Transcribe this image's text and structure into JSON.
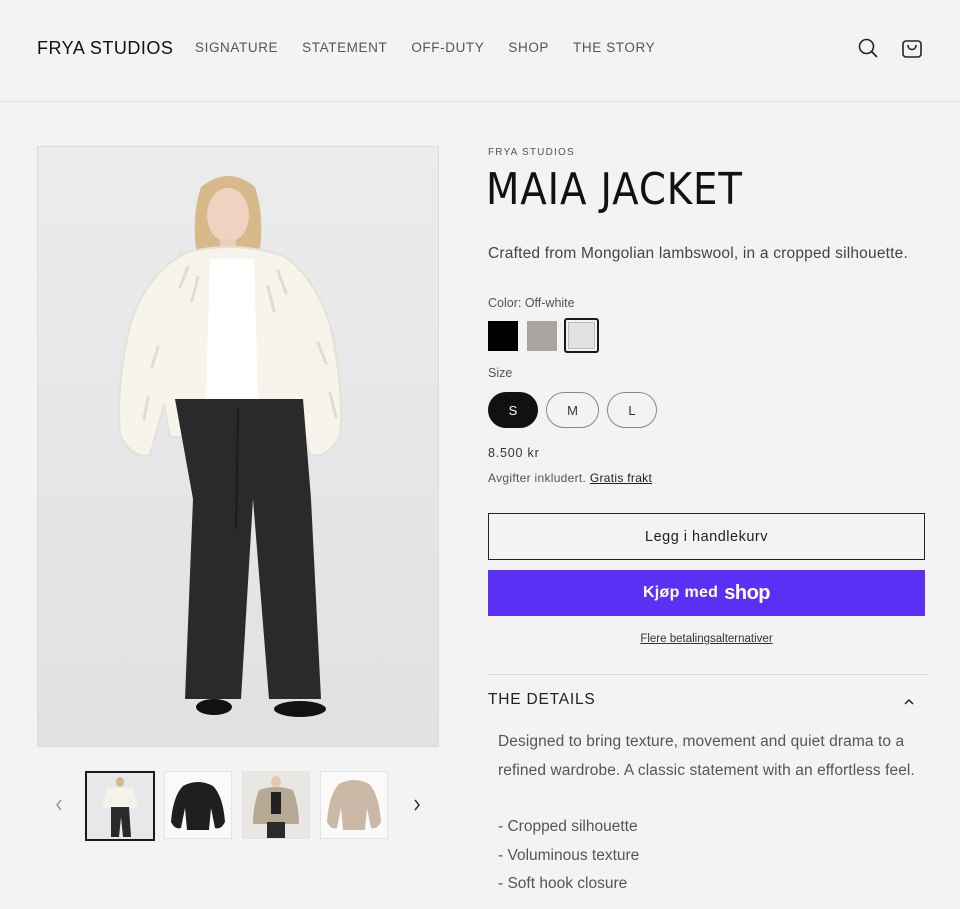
{
  "header": {
    "logo": "FRYA STUDIOS",
    "nav": [
      "SIGNATURE",
      "STATEMENT",
      "OFF-DUTY",
      "SHOP",
      "THE STORY"
    ],
    "icons": [
      "search-icon",
      "cart-icon"
    ]
  },
  "product": {
    "vendor": "FRYA STUDIOS",
    "title": "MAIA JACKET",
    "description": "Crafted from Mongolian lambswool, in a cropped silhouette.",
    "color_label": "Color: Off-white",
    "swatches": [
      {
        "name": "Black",
        "color": "#000000"
      },
      {
        "name": "Taupe",
        "color": "#a9a3a1"
      },
      {
        "name": "Off-white",
        "color": "#e2e2e2",
        "selected": true
      }
    ],
    "size_label": "Size",
    "sizes": [
      "S",
      "M",
      "L"
    ],
    "selected_size": "S",
    "price": "8.500 kr",
    "tax_text": "Avgifter inkludert.",
    "shipping_link": "Gratis frakt",
    "add_to_cart": "Legg i handlekurv",
    "shop_pay_text": "Kjøp med",
    "shop_pay_brand": "shop",
    "shop_pay_color": "#5a31f4",
    "more_payment": "Flere betalingsalternativer"
  },
  "details": {
    "title": "THE DETAILS",
    "body": "Designed to bring texture, movement and quiet drama to a refined wardrobe. A classic statement with an effortless feel.",
    "bullets": [
      "- Cropped silhouette",
      "- Voluminous texture",
      "- Soft hook closure"
    ]
  }
}
